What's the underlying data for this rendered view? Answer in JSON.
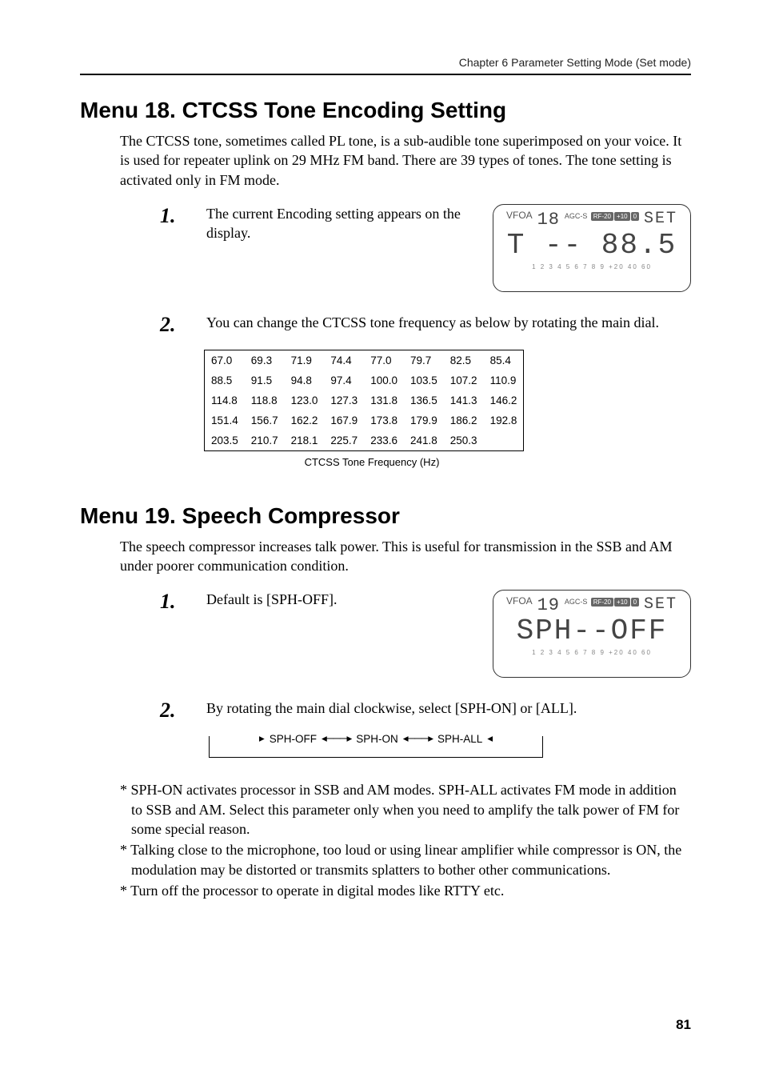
{
  "running_head": "Chapter 6   Parameter Setting Mode (Set mode)",
  "menu18": {
    "title": "Menu 18.  CTCSS Tone Encoding Setting",
    "intro": "The CTCSS tone, sometimes called PL tone, is a sub-audible tone superimposed on your voice. It is used for repeater uplink on 29 MHz FM band. There are 39 types of tones. The tone setting is activated only in FM mode.",
    "step1_num": "1.",
    "step1_text": "The current Encoding setting appears on the display.",
    "display1": {
      "vfo": "VFOA",
      "menu_no": "18",
      "agc": "AGC-S",
      "icons": [
        "RF-20",
        "+10",
        "0"
      ],
      "set": "SET",
      "main": "T --   88.5",
      "scale": "1 2 3 4 5 6 7 8 9  +20  40  60"
    },
    "step2_num": "2.",
    "step2_text": "You can change the CTCSS tone frequency as below by rotating the main dial.",
    "tone_rows": [
      [
        "67.0",
        "69.3",
        "71.9",
        "74.4",
        "77.0",
        "79.7",
        "82.5",
        "85.4"
      ],
      [
        "88.5",
        "91.5",
        "94.8",
        "97.4",
        "100.0",
        "103.5",
        "107.2",
        "110.9"
      ],
      [
        "114.8",
        "118.8",
        "123.0",
        "127.3",
        "131.8",
        "136.5",
        "141.3",
        "146.2"
      ],
      [
        "151.4",
        "156.7",
        "162.2",
        "167.9",
        "173.8",
        "179.9",
        "186.2",
        "192.8"
      ],
      [
        "203.5",
        "210.7",
        "218.1",
        "225.7",
        "233.6",
        "241.8",
        "250.3",
        ""
      ]
    ],
    "tone_caption": "CTCSS Tone Frequency (Hz)"
  },
  "menu19": {
    "title": "Menu 19.  Speech Compressor",
    "intro": "The speech compressor increases talk power. This is useful for transmission in the SSB and AM under poorer communication condition.",
    "step1_num": "1.",
    "step1_text": "Default is [SPH-OFF].",
    "display1": {
      "vfo": "VFOA",
      "menu_no": "19",
      "agc": "AGC-S",
      "icons": [
        "RF-20",
        "+10",
        "0"
      ],
      "set": "SET",
      "main": "SPH--OFF",
      "scale": "1 2 3 4 5 6 7 8 9  +20  40  60"
    },
    "step2_num": "2.",
    "step2_text": "By rotating the main dial clockwise, select [SPH-ON] or [ALL].",
    "cycle": [
      "SPH-OFF",
      "SPH-ON",
      "SPH-ALL"
    ],
    "notes": [
      "* SPH-ON activates processor in SSB and AM modes. SPH-ALL activates FM mode in addition to SSB and AM. Select this parameter only when you need to amplify the talk power of FM for some special reason.",
      "* Talking close to the microphone, too loud or using linear amplifier while compressor is ON, the modulation may be distorted or transmits splatters to bother other communications.",
      "* Turn off the processor to operate in digital modes like RTTY etc."
    ]
  },
  "page_no": "81"
}
